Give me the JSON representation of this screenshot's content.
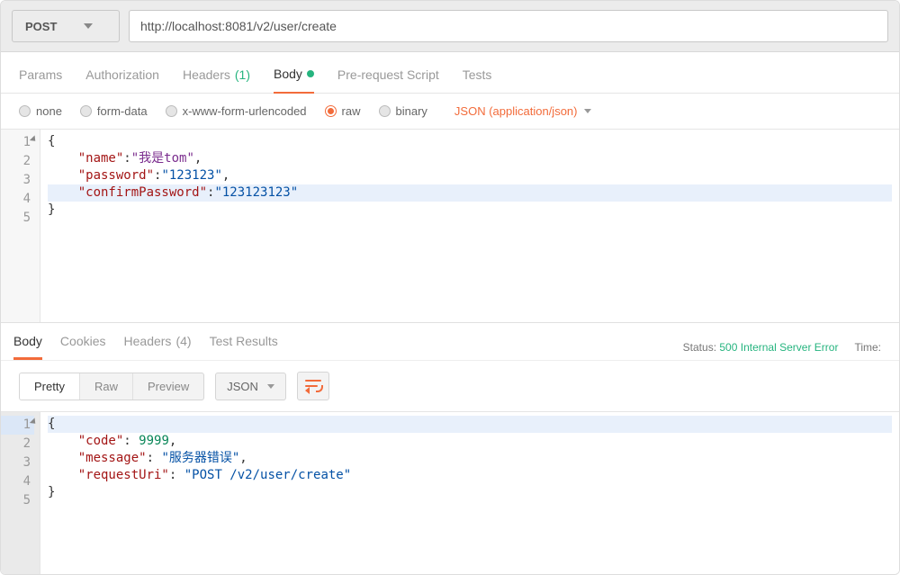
{
  "request": {
    "method": "POST",
    "url": "http://localhost:8081/v2/user/create"
  },
  "request_tabs": {
    "params": "Params",
    "authorization": "Authorization",
    "headers": "Headers",
    "headers_count": "(1)",
    "body": "Body",
    "prerequest": "Pre-request Script",
    "tests": "Tests"
  },
  "body_types": {
    "none": "none",
    "formdata": "form-data",
    "xwww": "x-www-form-urlencoded",
    "raw": "raw",
    "binary": "binary",
    "content_type": "JSON (application/json)"
  },
  "request_body": {
    "lines": [
      "1",
      "2",
      "3",
      "4",
      "5"
    ],
    "name_key": "\"name\"",
    "name_val": "\"我是tom\"",
    "password_key": "\"password\"",
    "password_val": "\"123123\"",
    "confirm_key": "\"confirmPassword\"",
    "confirm_val": "\"123123123\""
  },
  "response": {
    "tabs": {
      "body": "Body",
      "cookies": "Cookies",
      "headers": "Headers",
      "headers_count": "(4)",
      "test_results": "Test Results"
    },
    "status_label": "Status:",
    "status_value": "500 Internal Server Error",
    "time_label": "Time:"
  },
  "view_modes": {
    "pretty": "Pretty",
    "raw": "Raw",
    "preview": "Preview",
    "format": "JSON"
  },
  "response_body": {
    "lines": [
      "1",
      "2",
      "3",
      "4",
      "5"
    ],
    "code_key": "\"code\"",
    "code_val": "9999",
    "message_key": "\"message\"",
    "message_val": "\"服务器错误\"",
    "uri_key": "\"requestUri\"",
    "uri_val": "\"POST /v2/user/create\""
  }
}
